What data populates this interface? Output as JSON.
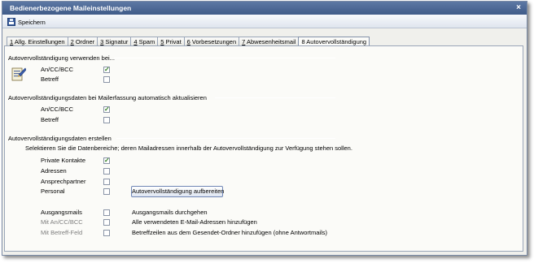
{
  "window": {
    "title": "Bedienerbezogene Maileinstellungen",
    "close_glyph": "×"
  },
  "toolbar": {
    "save_label": "Speichern",
    "save_icon": "floppy-disk-icon"
  },
  "tabs": [
    {
      "key": "1",
      "label": " Allg. Einstellungen"
    },
    {
      "key": "2",
      "label": " Ordner"
    },
    {
      "key": "3",
      "label": " Signatur"
    },
    {
      "key": "4",
      "label": " Spam"
    },
    {
      "key": "5",
      "label": " Privat"
    },
    {
      "key": "6",
      "label": " Vorbesetzungen"
    },
    {
      "key": "7",
      "label": " Abwesenheitsmail"
    },
    {
      "key": "8",
      "label": " Autovervollständigung"
    }
  ],
  "group1": {
    "title": "Autovervollständigung verwenden bei...",
    "items": [
      {
        "label": "An/CC/BCC",
        "checked": "✓"
      },
      {
        "label": "Betreff",
        "checked": ""
      }
    ]
  },
  "group2": {
    "title": "Autovervollständigungsdaten bei Mailerfassung automatisch aktualisieren",
    "items": [
      {
        "label": "An/CC/BCC",
        "checked": "✓"
      },
      {
        "label": "Betreff",
        "checked": ""
      }
    ]
  },
  "group3": {
    "title": "Autovervollständigungsdaten erstellen",
    "description": "Selektieren Sie die Datenbereiche; deren Mailadressen innerhalb der Autovervollständigung zur Verfügung stehen sollen.",
    "items": [
      {
        "label": "Private Kontakte",
        "checked": "✓"
      },
      {
        "label": "Adressen",
        "checked": ""
      },
      {
        "label": "Ansprechpartner",
        "checked": ""
      },
      {
        "label": "Personal",
        "checked": ""
      }
    ],
    "prepare_button": "Autovervollständigung aufbereiten",
    "extra": [
      {
        "label": "Ausgangsmails",
        "checked": "",
        "desc": "Ausgangsmails durchgehen"
      },
      {
        "label": "Mit An/CC/BCC",
        "checked": "",
        "desc": "Alle verwendeten E-Mail-Adressen hinzufügen"
      },
      {
        "label": "Mit Betreff-Feld",
        "checked": "",
        "desc": "Betreffzeilen aus dem Gesendet-Ordner hinzufügen (ohne Antwortmails)"
      }
    ]
  }
}
